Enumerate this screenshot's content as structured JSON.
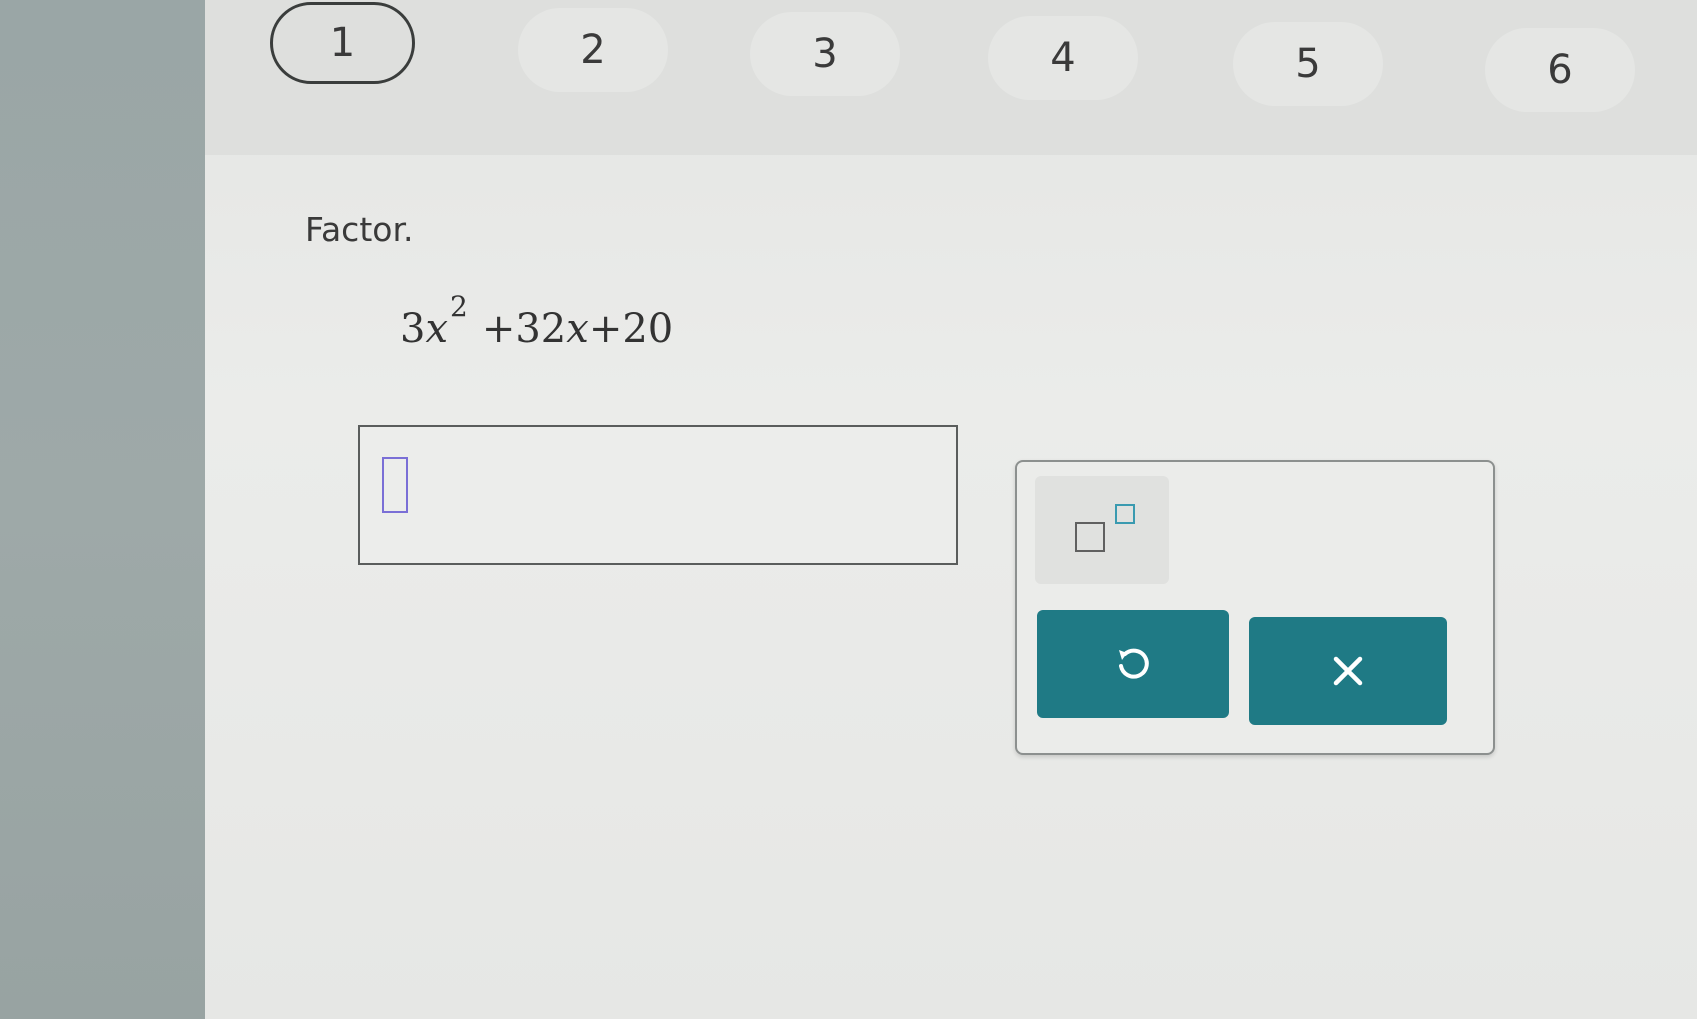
{
  "steps": [
    "1",
    "2",
    "3",
    "4",
    "5",
    "6"
  ],
  "active_step": "1",
  "question": {
    "instruction": "Factor.",
    "expression": {
      "coef1": "3",
      "var1": "x",
      "exp": "2",
      "rest1": "+32",
      "var2": "x",
      "rest2": "+20"
    }
  },
  "answer": {
    "value": ""
  },
  "palette": {
    "exponent_key": "exponent-template",
    "undo_icon": "undo-icon",
    "clear_icon": "close-icon"
  },
  "colors": {
    "button_teal": "#1f7a85",
    "cursor_purple": "#7a6fd6"
  }
}
